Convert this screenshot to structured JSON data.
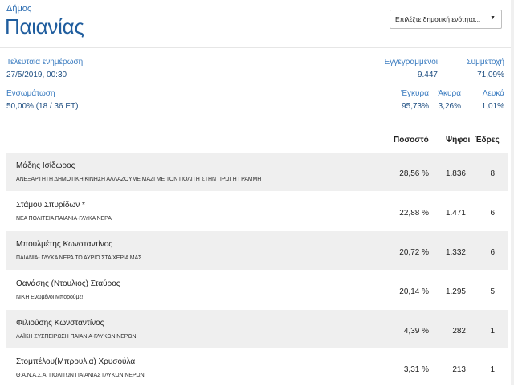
{
  "header": {
    "subtitle": "Δήμος",
    "title": "Παιανίας",
    "select_placeholder": "Επιλέξτε δημοτική ενότητα..."
  },
  "info": {
    "updated_label": "Τελευταία ενημέρωση",
    "updated_value": "27/5/2019, 00:30",
    "integration_label": "Ενσωμάτωση",
    "integration_value": "50,00% (18 / 36 ΕΤ)",
    "registered_label": "Εγγεγραμμένοι",
    "registered_value": "9.447",
    "turnout_label": "Συμμετοχή",
    "turnout_value": "71,09%",
    "valid_label": "Έγκυρα",
    "valid_value": "95,73%",
    "invalid_label": "Άκυρα",
    "invalid_value": "3,26%",
    "blank_label": "Λευκά",
    "blank_value": "1,01%"
  },
  "table": {
    "headers": {
      "percent": "Ποσοστό",
      "votes": "Ψήφοι",
      "seats": "Έδρες"
    },
    "rows": [
      {
        "candidate": "Μάδης Ισίδωρος",
        "party": "ΑΝΕΞΑΡΤΗΤΗ ΔΗΜΟΤΙΚΗ ΚΙΝΗΣΗ ΑΛΛΑΖΟΥΜΕ ΜΑΖΙ ΜΕ ΤΟΝ ΠΟΛΙΤΗ ΣΤΗΝ ΠΡΩΤΗ ΓΡΑΜΜΗ",
        "percent": "28,56 %",
        "votes": "1.836",
        "seats": "8"
      },
      {
        "candidate": "Στάμου Σπυρίδων *",
        "party": "ΝΕΑ ΠΟΛΙΤΕΙΑ ΠΑΙΑΝΙΑ-ΓΛΥΚΑ ΝΕΡΑ",
        "percent": "22,88 %",
        "votes": "1.471",
        "seats": "6"
      },
      {
        "candidate": "Μπουλμέτης Κωνσταντίνος",
        "party": "ΠΑΙΑΝΙΑ- ΓΛΥΚΑ ΝΕΡΑ ΤΟ ΑΥΡΙΟ ΣΤΑ ΧΕΡΙΑ ΜΑΣ",
        "percent": "20,72 %",
        "votes": "1.332",
        "seats": "6"
      },
      {
        "candidate": "Θανάσης (Ντουλιος) Σταύρος",
        "party": "ΝΙΚΗ Ενωμένοι Μπορούμε!",
        "percent": "20,14 %",
        "votes": "1.295",
        "seats": "5"
      },
      {
        "candidate": "Φιλιούσης Κωνσταντίνος",
        "party": "ΛΑΪΚΗ ΣΥΣΠΕΙΡΩΣΗ ΠΑΙΑΝΙΑ-ΓΛΥΚΩΝ ΝΕΡΩΝ",
        "percent": "4,39 %",
        "votes": "282",
        "seats": "1"
      },
      {
        "candidate": "Στομπέλου(Μπρουλια) Χρυσούλα",
        "party": "Θ.Α.Ν.Α.Σ.Α. ΠΟΛΙΤΩΝ ΠΑΙΑΝΙΑΣ ΓΛΥΚΩΝ ΝΕΡΩΝ",
        "percent": "3,31 %",
        "votes": "213",
        "seats": "1"
      }
    ]
  }
}
